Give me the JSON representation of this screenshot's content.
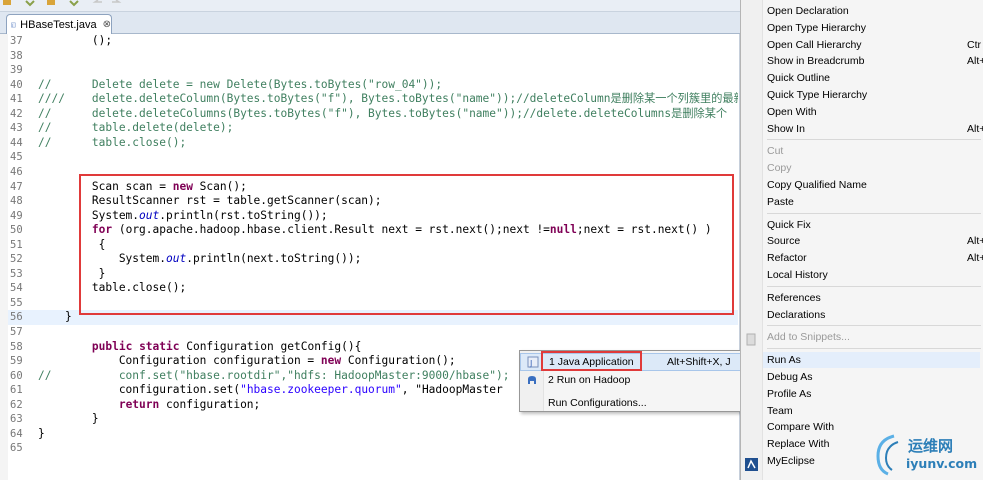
{
  "editor": {
    "tab_title": "HBaseTest.java",
    "tab_close": "⊗",
    "lines": [
      {
        "n": "37",
        "html": "        ();",
        "kind": "partial"
      },
      {
        "n": "38",
        "text": ""
      },
      {
        "n": "39",
        "text": ""
      },
      {
        "n": "40",
        "prefix": "//      ",
        "text": "Delete delete = new Delete(Bytes.toBytes(\"row_04\"));",
        "kind": "comment"
      },
      {
        "n": "41",
        "prefix": "////    ",
        "text": "delete.deleteColumn(Bytes.toBytes(\"f\"), Bytes.toBytes(\"name\"));//deleteColumn是删除某一个列簇里的最新",
        "kind": "comment"
      },
      {
        "n": "42",
        "prefix": "//      ",
        "text": "delete.deleteColumns(Bytes.toBytes(\"f\"), Bytes.toBytes(\"name\"));//delete.deleteColumns是删除某个",
        "kind": "comment"
      },
      {
        "n": "43",
        "prefix": "//      ",
        "text": "table.delete(delete);",
        "kind": "comment"
      },
      {
        "n": "44",
        "prefix": "//      ",
        "text": "table.close();",
        "kind": "comment"
      },
      {
        "n": "45",
        "text": ""
      },
      {
        "n": "46",
        "text": ""
      },
      {
        "n": "47",
        "text": "        Scan scan = new Scan();"
      },
      {
        "n": "48",
        "text": "        ResultScanner rst = table.getScanner(scan);"
      },
      {
        "n": "49",
        "text": "        System.out.println(rst.toString());"
      },
      {
        "n": "50",
        "text": "        for (org.apache.hadoop.hbase.client.Result next = rst.next();next !=null;next = rst.next() )"
      },
      {
        "n": "51",
        "text": "         {"
      },
      {
        "n": "52",
        "text": "            System.out.println(next.toString());"
      },
      {
        "n": "53",
        "text": "         }"
      },
      {
        "n": "54",
        "text": "        table.close();"
      },
      {
        "n": "55",
        "text": ""
      },
      {
        "n": "56",
        "text": "    }"
      },
      {
        "n": "57",
        "text": ""
      },
      {
        "n": "58",
        "text": "        public static Configuration getConfig(){"
      },
      {
        "n": "59",
        "text": "            Configuration configuration = new Configuration();"
      },
      {
        "n": "60",
        "prefix": "//          ",
        "text": "conf.set(\"hbase.rootdir\",\"hdfs: HadoopMaster:9000/hbase\");",
        "kind": "comment"
      },
      {
        "n": "61",
        "text": "            configuration.set(\"hbase.zookeeper.quorum\", \"HadoopMaster"
      },
      {
        "n": "62",
        "text": "            return configuration;"
      },
      {
        "n": "63",
        "text": "        }"
      },
      {
        "n": "64",
        "text": "}"
      },
      {
        "n": "65",
        "text": ""
      }
    ]
  },
  "submenu": {
    "items": [
      {
        "label": "1 Java Application",
        "shortcut": "Alt+Shift+X, J",
        "icon": "java-application-icon"
      },
      {
        "label": "2 Run on Hadoop",
        "shortcut": "",
        "icon": "hadoop-elephant-icon"
      },
      {
        "label": "Run Configurations...",
        "shortcut": "",
        "icon": ""
      }
    ]
  },
  "context_menu": {
    "groups": [
      [
        {
          "label": "Open Declaration",
          "shortcut": ""
        },
        {
          "label": "Open Type Hierarchy",
          "shortcut": ""
        },
        {
          "label": "Open Call Hierarchy",
          "shortcut": "Ctr"
        },
        {
          "label": "Show in Breadcrumb",
          "shortcut": "Alt+"
        },
        {
          "label": "Quick Outline",
          "shortcut": ""
        },
        {
          "label": "Quick Type Hierarchy",
          "shortcut": ""
        },
        {
          "label": "Open With",
          "shortcut": ""
        },
        {
          "label": "Show In",
          "shortcut": "Alt+S"
        }
      ],
      [
        {
          "label": "Cut",
          "shortcut": "",
          "disabled": true
        },
        {
          "label": "Copy",
          "shortcut": "",
          "disabled": true
        },
        {
          "label": "Copy Qualified Name",
          "shortcut": ""
        },
        {
          "label": "Paste",
          "shortcut": ""
        }
      ],
      [
        {
          "label": "Quick Fix",
          "shortcut": ""
        },
        {
          "label": "Source",
          "shortcut": "Alt+"
        },
        {
          "label": "Refactor",
          "shortcut": "Alt+"
        },
        {
          "label": "Local History",
          "shortcut": ""
        }
      ],
      [
        {
          "label": "References",
          "shortcut": ""
        },
        {
          "label": "Declarations",
          "shortcut": ""
        }
      ],
      [
        {
          "label": "Add to Snippets...",
          "shortcut": "",
          "disabled": true
        }
      ],
      [
        {
          "label": "Run As",
          "shortcut": "",
          "selected": true
        },
        {
          "label": "Debug As",
          "shortcut": ""
        },
        {
          "label": "Profile As",
          "shortcut": ""
        },
        {
          "label": "Team",
          "shortcut": ""
        },
        {
          "label": "Compare With",
          "shortcut": ""
        },
        {
          "label": "Replace With",
          "shortcut": ""
        },
        {
          "label": "MyEclipse",
          "shortcut": ""
        }
      ]
    ]
  },
  "watermark": {
    "cn": "运维网",
    "url": "iyunv.com"
  },
  "colors": {
    "highlight": "#e03a3a",
    "keyword": "#7f0055",
    "comment": "#3f7f5f",
    "string": "#2a00ff"
  }
}
